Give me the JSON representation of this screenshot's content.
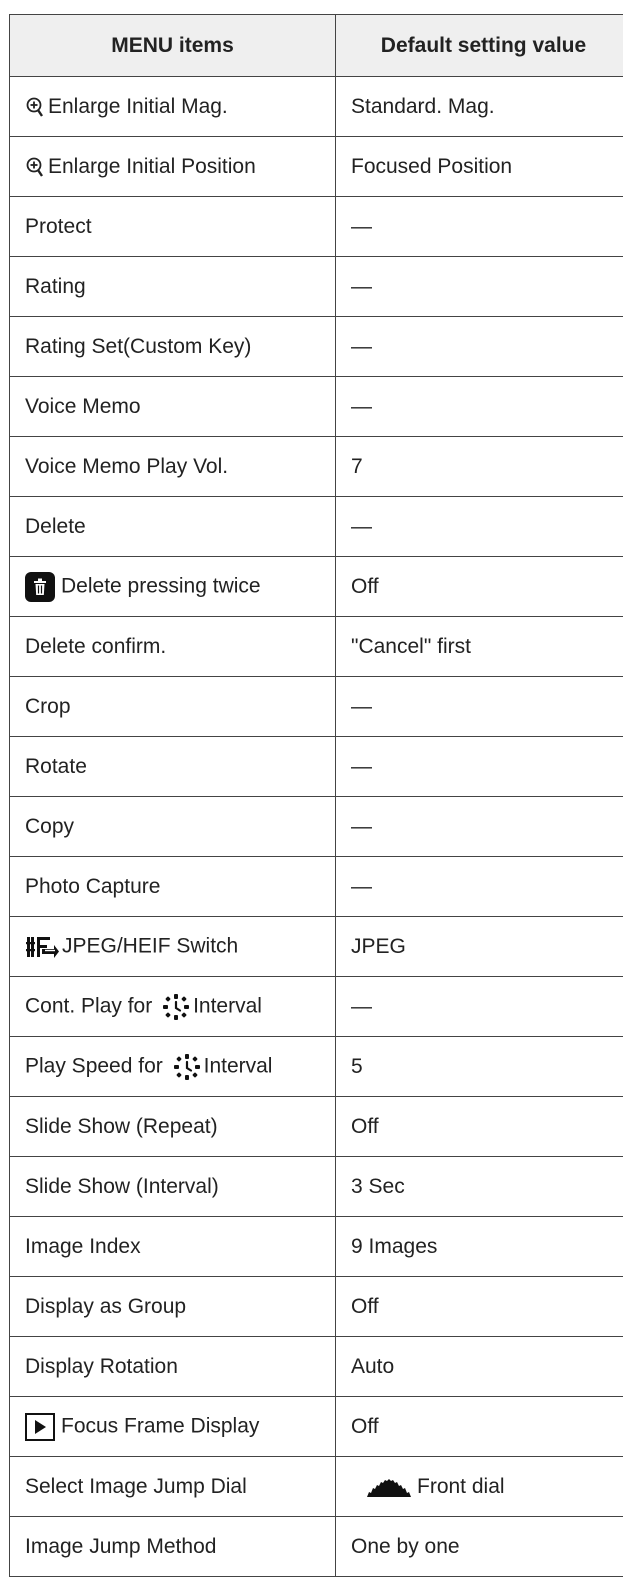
{
  "table": {
    "headers": [
      "MENU items",
      "Default setting value"
    ],
    "rows": [
      {
        "icon": "zoom-in-icon",
        "item": "Enlarge Initial Mag.",
        "value": "Standard. Mag."
      },
      {
        "icon": "zoom-in-icon",
        "item": "Enlarge Initial Position",
        "value": "Focused Position"
      },
      {
        "icon": null,
        "item": "Protect",
        "value": "—"
      },
      {
        "icon": null,
        "item": "Rating",
        "value": "—"
      },
      {
        "icon": null,
        "item": "Rating Set(Custom Key)",
        "value": "—"
      },
      {
        "icon": null,
        "item": "Voice Memo",
        "value": "—"
      },
      {
        "icon": null,
        "item": "Voice Memo Play Vol.",
        "value": "7"
      },
      {
        "icon": null,
        "item": "Delete",
        "value": "—"
      },
      {
        "icon": "trash-icon",
        "item": "Delete pressing twice",
        "value": "Off"
      },
      {
        "icon": null,
        "item": "Delete confirm.",
        "value": "\"Cancel\" first"
      },
      {
        "icon": null,
        "item": "Crop",
        "value": "—"
      },
      {
        "icon": null,
        "item": "Rotate",
        "value": "—"
      },
      {
        "icon": null,
        "item": "Copy",
        "value": "—"
      },
      {
        "icon": null,
        "item": "Photo Capture",
        "value": "—"
      },
      {
        "icon": "jpeg-heif-switch-icon",
        "item": "JPEG/HEIF Switch",
        "value": "JPEG"
      },
      {
        "item_before": "Cont. Play for",
        "icon_inline": "interval-icon",
        "item": "Interval",
        "value": "—"
      },
      {
        "item_before": "Play Speed for",
        "icon_inline": "interval-icon",
        "item": "Interval",
        "value": "5"
      },
      {
        "icon": null,
        "item": "Slide Show (Repeat)",
        "value": "Off"
      },
      {
        "icon": null,
        "item": "Slide Show (Interval)",
        "value": "3 Sec"
      },
      {
        "icon": null,
        "item": "Image Index",
        "value": "9 Images"
      },
      {
        "icon": null,
        "item": "Display as Group",
        "value": "Off"
      },
      {
        "icon": null,
        "item": "Display Rotation",
        "value": "Auto"
      },
      {
        "icon": "playback-icon",
        "item": "Focus Frame Display",
        "value": "Off"
      },
      {
        "icon": null,
        "item": "Select Image Jump Dial",
        "value_icon": "front-dial-icon",
        "value": "Front dial"
      },
      {
        "icon": null,
        "item": "Image Jump Method",
        "value": "One by one"
      }
    ]
  }
}
